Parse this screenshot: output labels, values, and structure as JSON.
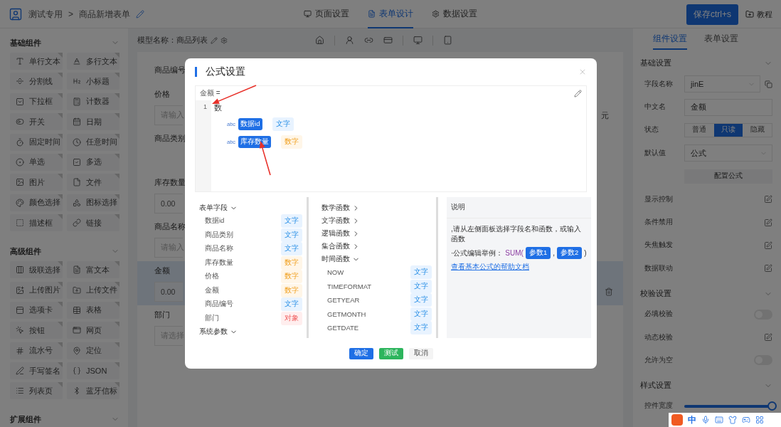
{
  "top_bar": {
    "breadcrumb": [
      {
        "label": "测试专用"
      },
      {
        "label": "商品新增表单"
      }
    ],
    "separator": ">",
    "tabs": [
      {
        "label": "页面设置",
        "selected": false
      },
      {
        "label": "表单设计",
        "selected": true
      },
      {
        "label": "数据设置",
        "selected": false
      }
    ],
    "save_button": "保存ctrl+s",
    "tutorial_link": "教程"
  },
  "palette": {
    "sections": [
      {
        "title": "基础组件",
        "items": [
          "单行文本",
          "多行文本",
          "分割线",
          "小标题",
          "下拉框",
          "计数器",
          "开关",
          "日期",
          "固定时间",
          "任意时间",
          "单选",
          "多选",
          "图片",
          "文件",
          "颜色选择",
          "图标选择",
          "描述框",
          "链接"
        ]
      },
      {
        "title": "高级组件",
        "items": [
          "级联选择",
          "富文本",
          "上传图片",
          "上传文件",
          "选项卡",
          "表格",
          "按钮",
          "网页",
          "流水号",
          "定位",
          "手写签名",
          "JSON",
          "列表页",
          "蓝牙信标"
        ]
      },
      {
        "title": "扩展组件"
      }
    ]
  },
  "canvas": {
    "model_name": "模型名称：商品列表",
    "fields": [
      {
        "label": "商品编号",
        "selected": false
      },
      {
        "label": "价格",
        "placeholder": "请输入",
        "suffix": "元",
        "selected": false
      },
      {
        "label": "商品类别",
        "selected": false
      },
      {
        "label": "库存数量",
        "value": "0.00",
        "selected": false
      },
      {
        "label": "商品名称",
        "placeholder": "请输入",
        "selected": false
      },
      {
        "label": "金额",
        "value": "0.00",
        "selected": true
      },
      {
        "label": "部门",
        "placeholder": "请选择",
        "selected": false
      }
    ]
  },
  "settings_panel": {
    "tabs": [
      {
        "label": "组件设置",
        "selected": true
      },
      {
        "label": "表单设置",
        "selected": false
      }
    ],
    "sections": [
      {
        "title": "基础设置",
        "rows": [
          {
            "kind": "select",
            "label": "字段名称",
            "value": "jinE",
            "copyable": true
          },
          {
            "kind": "input",
            "label": "中文名",
            "value": "金额"
          },
          {
            "kind": "segmented",
            "label": "状态",
            "options": [
              {
                "label": "普通",
                "selected": false
              },
              {
                "label": "只读",
                "selected": true
              },
              {
                "label": "隐藏",
                "selected": false
              }
            ]
          },
          {
            "kind": "select",
            "label": "默认值",
            "value": "公式",
            "copyable": false
          },
          {
            "kind": "button",
            "label": "配置公式"
          },
          {
            "kind": "edit",
            "label": "显示控制"
          },
          {
            "kind": "edit",
            "label": "条件禁用"
          },
          {
            "kind": "edit",
            "label": "失焦触发"
          },
          {
            "kind": "edit",
            "label": "数据联动"
          }
        ]
      },
      {
        "title": "校验设置",
        "rows": [
          {
            "kind": "toggle",
            "label": "必填校验",
            "on": false
          },
          {
            "kind": "edit",
            "label": "动态校验"
          },
          {
            "kind": "toggle",
            "label": "允许为空",
            "on": false
          }
        ]
      },
      {
        "title": "样式设置",
        "rows": [
          {
            "kind": "slider",
            "label": "控件宽度",
            "level": 1
          }
        ]
      }
    ]
  },
  "formula_dialog": {
    "title": "公式设置",
    "target": "金额 =",
    "line_number": "1",
    "code": "数",
    "suggestions": [
      {
        "prefix": "abc",
        "name": "数据id",
        "type": "文字",
        "kind": "text"
      },
      {
        "prefix": "abc",
        "name": "库存数量",
        "type": "数字",
        "kind": "number"
      }
    ],
    "field_groups": [
      {
        "title": "表单字段",
        "items": [
          {
            "name": "数据id",
            "type": "文字",
            "kind": "text"
          },
          {
            "name": "商品类别",
            "type": "文字",
            "kind": "text"
          },
          {
            "name": "商品名称",
            "type": "文字",
            "kind": "text"
          },
          {
            "name": "库存数量",
            "type": "数字",
            "kind": "number"
          },
          {
            "name": "价格",
            "type": "数字",
            "kind": "number"
          },
          {
            "name": "金额",
            "type": "数字",
            "kind": "number"
          },
          {
            "name": "商品编号",
            "type": "文字",
            "kind": "text"
          },
          {
            "name": "部门",
            "type": "对象",
            "kind": "object"
          }
        ]
      },
      {
        "title": "系统参数"
      }
    ],
    "function_groups": [
      {
        "title": "数学函数",
        "expanded": false
      },
      {
        "title": "文字函数",
        "expanded": false
      },
      {
        "title": "逻辑函数",
        "expanded": false
      },
      {
        "title": "集合函数",
        "expanded": false
      },
      {
        "title": "时间函数",
        "expanded": true,
        "items": [
          {
            "name": "NOW",
            "type": "文字",
            "kind": "text"
          },
          {
            "name": "TIMEFORMAT",
            "type": "文字",
            "kind": "text"
          },
          {
            "name": "GETYEAR",
            "type": "文字",
            "kind": "text"
          },
          {
            "name": "GETMONTH",
            "type": "文字",
            "kind": "text"
          },
          {
            "name": "GETDATE",
            "type": "文字",
            "kind": "text"
          }
        ]
      }
    ],
    "help": {
      "title": "说明",
      "hint": ",请从左侧面板选择字段名和函数，或输入函数",
      "example_label": "·公式编辑举例：",
      "example_function": "SUM(",
      "example_args": [
        "参数1",
        "参数2"
      ],
      "example_separator": ",",
      "example_close": ")",
      "link": "查看基本公式的帮助文档"
    },
    "buttons": [
      {
        "label": "确定",
        "kind": "primary"
      },
      {
        "label": "测试",
        "kind": "success"
      },
      {
        "label": "取消",
        "kind": "default"
      }
    ]
  },
  "ime_bar": {
    "mode": "中"
  }
}
